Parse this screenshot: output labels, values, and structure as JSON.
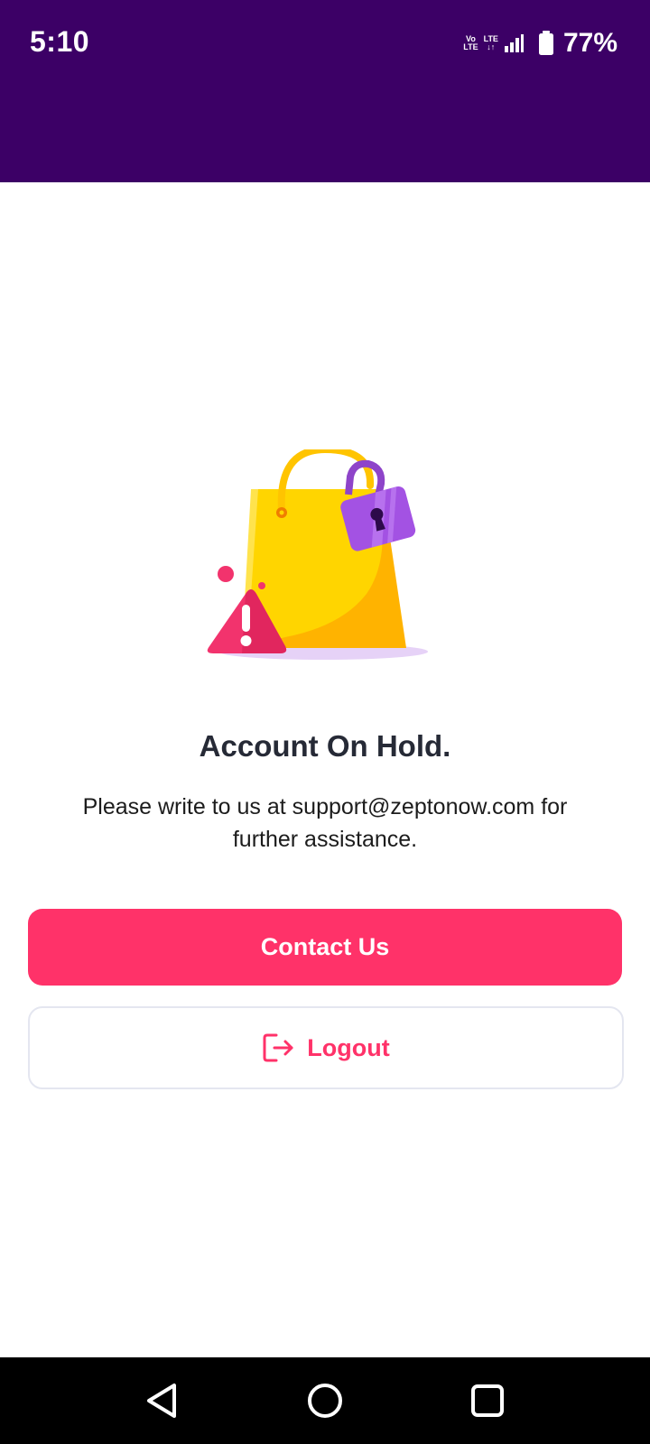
{
  "status_bar": {
    "time": "5:10",
    "network_tags": [
      "Vo LTE",
      "LTE"
    ],
    "battery_percent": "77%"
  },
  "page": {
    "title": "Account On Hold.",
    "message": "Please write to us at support@zeptonow.com for further assistance."
  },
  "buttons": {
    "contact_label": "Contact Us",
    "logout_label": "Logout"
  },
  "icons": {
    "illustration": "locked-shopping-bag-warning",
    "logout": "logout-icon",
    "nav_back": "back-triangle-icon",
    "nav_home": "home-circle-icon",
    "nav_recents": "recents-square-icon"
  },
  "colors": {
    "header": "#3c0066",
    "primary": "#ff3269",
    "title": "#262a36",
    "bag_yellow": "#ffd500",
    "bag_orange": "#ffb300",
    "lock_purple": "#9b4ddb"
  }
}
